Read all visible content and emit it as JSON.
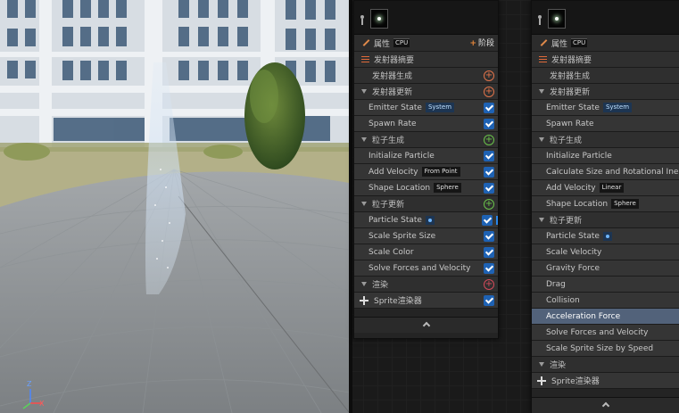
{
  "viewport": {
    "axis": {
      "z": "Z",
      "x": "X"
    }
  },
  "emitter_a": {
    "properties_label": "属性",
    "cpu_badge": "CPU",
    "stage_button": "阶段",
    "emitter_summary": "发射器摘要",
    "emitter_spawn": "发射器生成",
    "emitter_update": "发射器更新",
    "emitter_state": {
      "label": "Emitter State",
      "tag": "System"
    },
    "spawn_rate": "Spawn Rate",
    "particle_spawn": "粒子生成",
    "initialize_particle": "Initialize Particle",
    "add_velocity": {
      "label": "Add Velocity",
      "tag": "From Point"
    },
    "shape_location": {
      "label": "Shape Location",
      "tag": "Sphere"
    },
    "particle_update": "粒子更新",
    "particle_state": "Particle State",
    "scale_sprite_size": "Scale Sprite Size",
    "scale_color": "Scale Color",
    "solve_forces": "Solve Forces and Velocity",
    "render": "渲染",
    "sprite_renderer": "Sprite渲染器"
  },
  "emitter_b": {
    "properties_label": "属性",
    "cpu_badge": "CPU",
    "emitter_summary": "发射器摘要",
    "emitter_spawn": "发射器生成",
    "emitter_update": "发射器更新",
    "emitter_state": {
      "label": "Emitter State",
      "tag": "System"
    },
    "spawn_rate": "Spawn Rate",
    "particle_spawn": "粒子生成",
    "initialize_particle": "Initialize Particle",
    "calc_size": "Calculate Size and Rotational Inertia b",
    "add_velocity": {
      "label": "Add Velocity",
      "tag": "Linear"
    },
    "shape_location": {
      "label": "Shape Location",
      "tag": "Sphere"
    },
    "particle_update": "粒子更新",
    "particle_state": "Particle State",
    "scale_velocity": "Scale Velocity",
    "gravity_force": "Gravity Force",
    "drag": "Drag",
    "collision": "Collision",
    "acceleration_force": "Acceleration Force",
    "solve_forces": "Solve Forces and Velocity",
    "scale_sprite_by_speed": "Scale Sprite Size by Speed",
    "render": "渲染",
    "sprite_renderer": "Sprite渲染器"
  },
  "colors": {
    "checkbox": "#1e62b4",
    "selected_row": "#52627a",
    "add_orange": "#e0734a",
    "add_green": "#6ac24a",
    "add_red": "#d24a5a"
  }
}
